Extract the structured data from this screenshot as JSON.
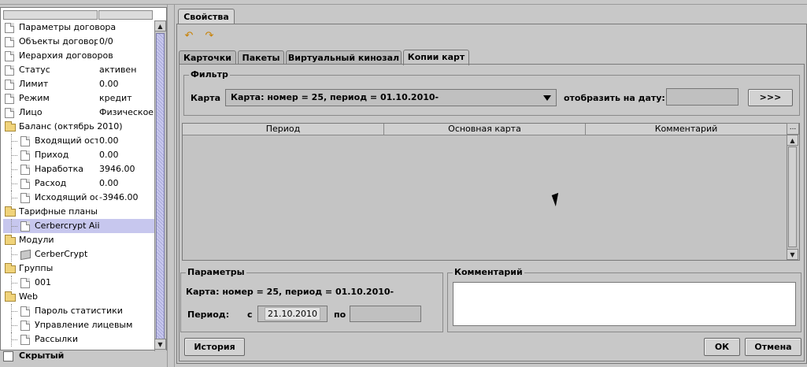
{
  "sidebar": {
    "tree": [
      {
        "label": "Параметры договора",
        "value": "",
        "icon": "document-icon",
        "indent": 0
      },
      {
        "label": "Объекты договора",
        "value": "0/0",
        "icon": "document-icon",
        "indent": 0
      },
      {
        "label": "Иерархия договоров",
        "value": "",
        "icon": "document-icon",
        "indent": 0
      },
      {
        "label": "Статус",
        "value": "активен",
        "icon": "document-icon",
        "indent": 0
      },
      {
        "label": "Лимит",
        "value": "0.00",
        "icon": "document-icon",
        "indent": 0
      },
      {
        "label": "Режим",
        "value": "кредит",
        "icon": "document-icon",
        "indent": 0
      },
      {
        "label": "Лицо",
        "value": "Физическое",
        "icon": "document-icon",
        "indent": 0
      },
      {
        "label": "Баланс (октябрь 2010)",
        "value": "",
        "icon": "folder-icon",
        "indent": 0
      },
      {
        "label": "Входящий остаток",
        "value": "0.00",
        "icon": "document-icon",
        "indent": 1
      },
      {
        "label": "Приход",
        "value": "0.00",
        "icon": "document-icon",
        "indent": 1
      },
      {
        "label": "Наработка",
        "value": "3946.00",
        "icon": "document-icon",
        "indent": 1
      },
      {
        "label": "Расход",
        "value": "0.00",
        "icon": "document-icon",
        "indent": 1
      },
      {
        "label": "Исходящий остаток",
        "value": "-3946.00",
        "icon": "document-icon",
        "indent": 1
      },
      {
        "label": "Тарифные планы",
        "value": "",
        "icon": "folder-icon",
        "indent": 0
      },
      {
        "label": "Cerbercrypt Aii",
        "value": "",
        "icon": "document-icon",
        "indent": 1,
        "selected": true
      },
      {
        "label": "Модули",
        "value": "",
        "icon": "folder-icon",
        "indent": 0
      },
      {
        "label": "CerberCrypt",
        "value": "",
        "icon": "module-icon",
        "indent": 1
      },
      {
        "label": "Группы",
        "value": "",
        "icon": "folder-icon",
        "indent": 0
      },
      {
        "label": "001",
        "value": "",
        "icon": "document-icon",
        "indent": 1
      },
      {
        "label": "Web",
        "value": "",
        "icon": "folder-icon",
        "indent": 0
      },
      {
        "label": "Пароль статистики",
        "value": "",
        "icon": "document-icon",
        "indent": 1
      },
      {
        "label": "Управление лицевым",
        "value": "",
        "icon": "document-icon",
        "indent": 1
      },
      {
        "label": "Рассылки",
        "value": "",
        "icon": "document-icon",
        "indent": 1
      }
    ],
    "hidden_checkbox_label": "Скрытый",
    "hidden_checked": false
  },
  "main": {
    "top_tab": "Свойства",
    "subtabs": [
      {
        "label": "Карточки",
        "active": false
      },
      {
        "label": "Пакеты",
        "active": false
      },
      {
        "label": "Виртуальный кинозал",
        "active": false
      },
      {
        "label": "Копии карт",
        "active": true
      }
    ],
    "filter": {
      "title": "Фильтр",
      "card_label": "Карта",
      "card_value": "Карта: номер = 25, период = 01.10.2010-",
      "date_label": "отобразить на дату:",
      "date_value": "",
      "go_button": ">>>"
    },
    "table": {
      "columns": [
        "Период",
        "Основная карта",
        "Комментарий"
      ],
      "rows": [],
      "more_button": "..."
    },
    "params": {
      "title": "Параметры",
      "card_text": "Карта: номер = 25, период = 01.10.2010-",
      "period_label": "Период:",
      "from_label": "с",
      "from_value": "21.10.2010",
      "to_label": "по",
      "to_value": ""
    },
    "comment": {
      "title": "Комментарий",
      "value": ""
    },
    "buttons": {
      "history": "История",
      "ok": "ОК",
      "cancel": "Отмена"
    }
  }
}
